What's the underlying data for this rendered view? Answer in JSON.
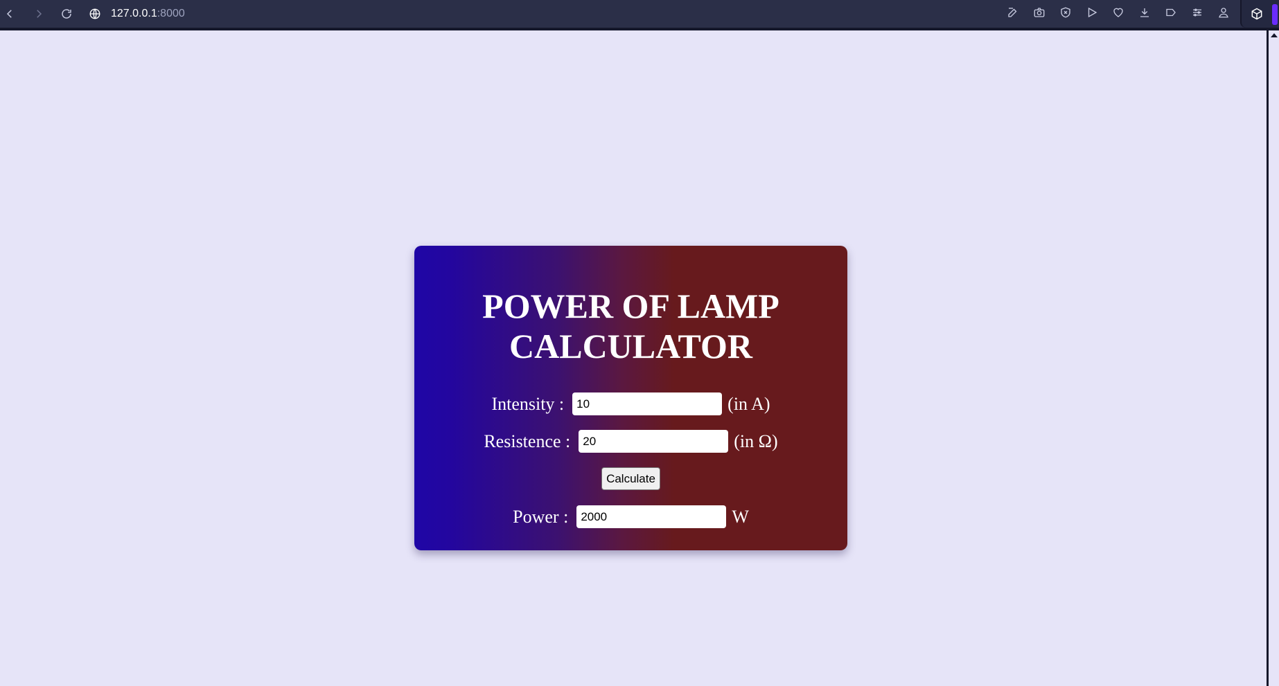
{
  "browser": {
    "url_host": "127.0.0.1",
    "url_port": ":8000",
    "right_icons": [
      "edit-icon",
      "camera-icon",
      "shield-x-icon",
      "play-icon",
      "heart-icon",
      "download-icon",
      "tag-icon",
      "settings-sliders-icon",
      "profile-icon"
    ],
    "extension_icon": "cube-icon",
    "accent_color": "#6a2cff"
  },
  "calculator": {
    "title_line1": "POWER OF LAMP",
    "title_line2": "CALCULATOR",
    "intensity_label": "Intensity :",
    "intensity_value": "10",
    "intensity_unit": "(in A)",
    "resistance_label": "Resistence :",
    "resistance_value": "20",
    "resistance_unit": "(in Ω)",
    "calculate_label": "Calculate",
    "power_label": "Power :",
    "power_value": "2000",
    "power_unit": "W",
    "gradient_left": "#1f06a6",
    "gradient_right": "#671a1d"
  }
}
